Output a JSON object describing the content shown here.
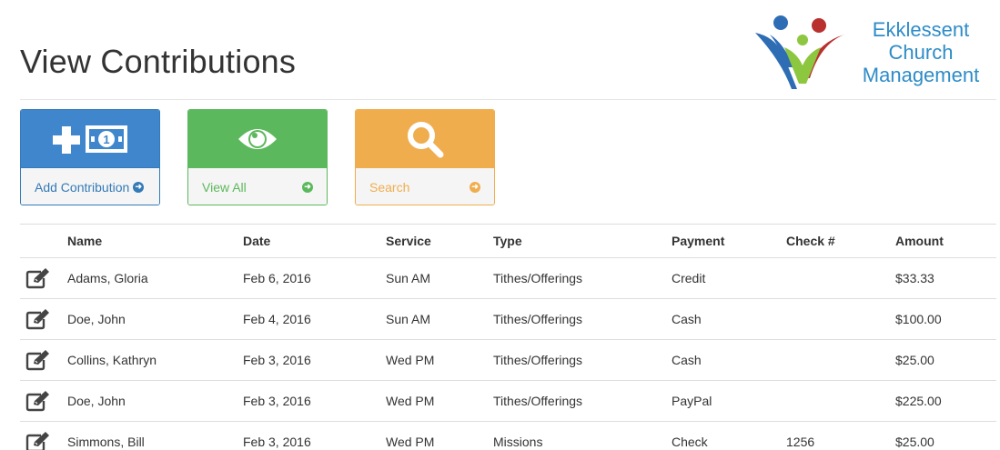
{
  "page": {
    "title": "View Contributions"
  },
  "logo": {
    "line1": "Ekklessent",
    "line2": "Church",
    "line3": "Management"
  },
  "actions": {
    "add": {
      "label": "Add Contribution",
      "icon": "plus-money-icon"
    },
    "view_all": {
      "label": "View All",
      "icon": "eye-icon"
    },
    "search": {
      "label": "Search",
      "icon": "search-icon"
    }
  },
  "table": {
    "headers": [
      "Name",
      "Date",
      "Service",
      "Type",
      "Payment",
      "Check #",
      "Amount"
    ],
    "rows": [
      {
        "name": "Adams, Gloria",
        "date": "Feb 6, 2016",
        "service": "Sun AM",
        "type": "Tithes/Offerings",
        "payment": "Credit",
        "check": "",
        "amount": "$33.33"
      },
      {
        "name": "Doe, John",
        "date": "Feb 4, 2016",
        "service": "Sun AM",
        "type": "Tithes/Offerings",
        "payment": "Cash",
        "check": "",
        "amount": "$100.00"
      },
      {
        "name": "Collins, Kathryn",
        "date": "Feb 3, 2016",
        "service": "Wed PM",
        "type": "Tithes/Offerings",
        "payment": "Cash",
        "check": "",
        "amount": "$25.00"
      },
      {
        "name": "Doe, John",
        "date": "Feb 3, 2016",
        "service": "Wed PM",
        "type": "Tithes/Offerings",
        "payment": "PayPal",
        "check": "",
        "amount": "$225.00"
      },
      {
        "name": "Simmons, Bill",
        "date": "Feb 3, 2016",
        "service": "Wed PM",
        "type": "Missions",
        "payment": "Check",
        "check": "1256",
        "amount": "$25.00"
      }
    ]
  },
  "colors": {
    "primary": "#337ab7",
    "success": "#5cb85c",
    "warning": "#f0ad4e",
    "logo_blue": "#2e8cc8"
  }
}
